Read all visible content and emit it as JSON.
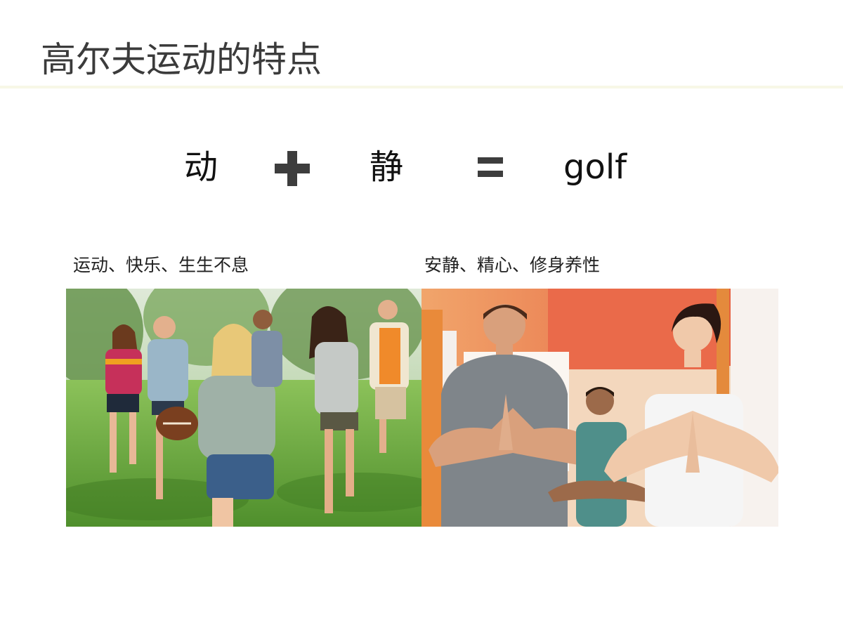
{
  "slide": {
    "title": "高尔夫运动的特点"
  },
  "equation": {
    "left_term": "动",
    "operator_plus_icon": "plus-icon",
    "right_term": "静",
    "operator_equals_icon": "equals-icon",
    "result": "golf",
    "operator_color": "#3d3d3d"
  },
  "panels": {
    "left": {
      "caption": "运动、快乐、生生不息"
    },
    "right": {
      "caption": "安静、精心、修身养性"
    }
  },
  "colors": {
    "title": "#3b3b3b",
    "rule": "#f7f7e6"
  }
}
